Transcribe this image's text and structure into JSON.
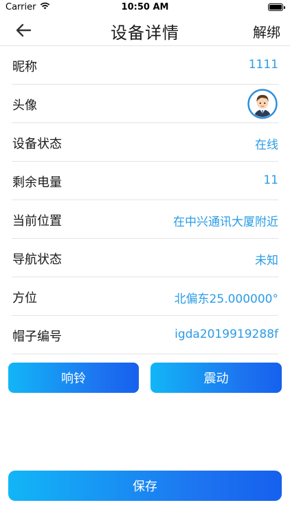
{
  "status_bar": {
    "carrier": "Carrier",
    "time": "10:50 AM"
  },
  "nav": {
    "title": "设备详情",
    "right_action": "解绑",
    "back_icon": "arrow-left-icon"
  },
  "rows": [
    {
      "label": "昵称",
      "value": "1111"
    },
    {
      "label": "头像",
      "value_icon": "avatar-boy-icon"
    },
    {
      "label": "设备状态",
      "value": "在线"
    },
    {
      "label": "剩余电量",
      "value": "11"
    },
    {
      "label": "当前位置",
      "value": "在中兴通讯大厦附近"
    },
    {
      "label": "导航状态",
      "value": "未知"
    },
    {
      "label": "方位",
      "value": "北偏东25.000000°"
    },
    {
      "label": "帽子编号",
      "value": "igda2019919288f"
    }
  ],
  "actions": {
    "ring_label": "响铃",
    "vibrate_label": "震动",
    "save_label": "保存"
  },
  "colors": {
    "accent_text": "#2a9ce6",
    "button_gradient_start": "#12b6f7",
    "button_gradient_end": "#1660ee",
    "divider": "#e3e3e3"
  }
}
